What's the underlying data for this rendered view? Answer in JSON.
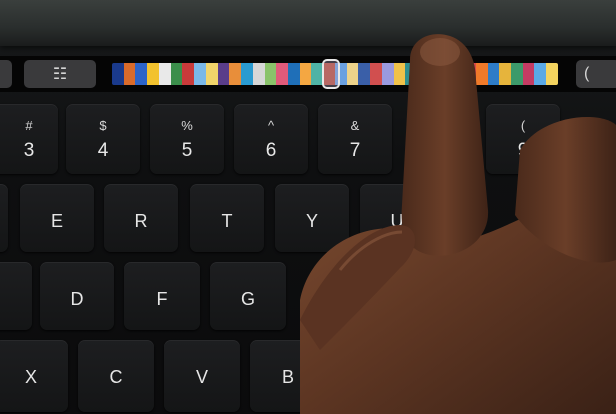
{
  "touch_bar": {
    "settings_icon": "sliders-icon",
    "settings_glyph": "☷",
    "right_glyph": "(",
    "thumbnail_colors": [
      "#1a3a8c",
      "#d96b2b",
      "#2c64c9",
      "#f2c22e",
      "#e9e9e9",
      "#3b8e4b",
      "#c93a3a",
      "#7ab8e8",
      "#f1d46a",
      "#5a3d8a",
      "#e88e3a",
      "#2a9bd1",
      "#d7d7d7",
      "#8ac36a",
      "#e05a7a",
      "#1f6fb8",
      "#f4a742",
      "#4fb3a5",
      "#b9452f",
      "#6aa0e0",
      "#ecd28a",
      "#3a5fa8",
      "#d14f4f",
      "#9a9adf",
      "#f0c24a",
      "#2f8f8f",
      "#e86a2b",
      "#c7c7c7",
      "#3b7fc4",
      "#e2463a",
      "#d94848",
      "#f07a2a",
      "#2e7cc7",
      "#e6b43c",
      "#3c9a6a",
      "#c43b63",
      "#5aa9e6",
      "#f3d35e"
    ]
  },
  "keys": {
    "row_numbers": [
      {
        "symbol": "#",
        "number": "3"
      },
      {
        "symbol": "$",
        "number": "4"
      },
      {
        "symbol": "%",
        "number": "5"
      },
      {
        "symbol": "^",
        "number": "6"
      },
      {
        "symbol": "&",
        "number": "7"
      },
      {
        "symbol": "(",
        "number": "9"
      }
    ],
    "row_top_letters": [
      "E",
      "R",
      "T",
      "Y",
      "U"
    ],
    "row_home_letters": [
      "D",
      "F",
      "G"
    ],
    "row_bottom_letters": [
      "X",
      "C",
      "V",
      "B"
    ]
  }
}
